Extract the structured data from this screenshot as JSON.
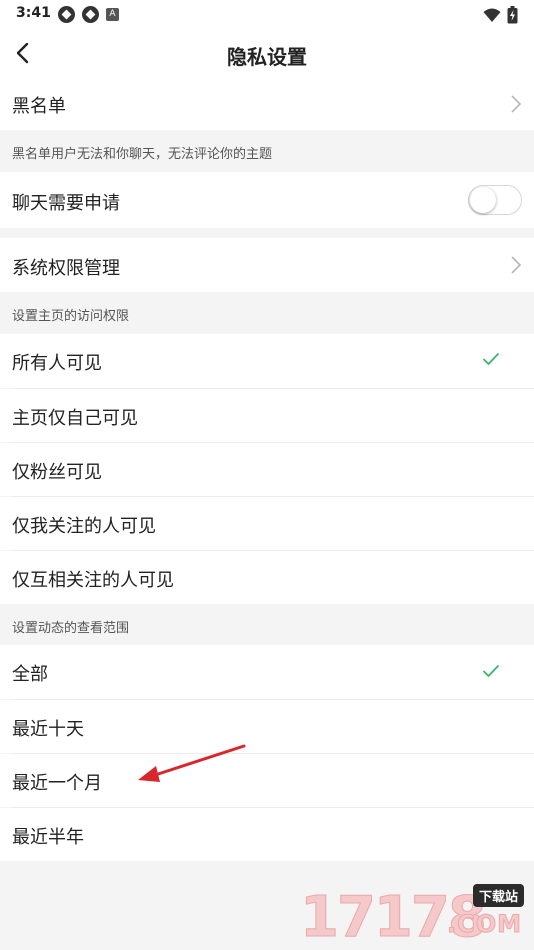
{
  "status": {
    "time": "3:41",
    "badge": "A"
  },
  "header": {
    "title": "隐私设置"
  },
  "blacklist": {
    "label": "黑名单",
    "note": "黑名单用户无法和你聊天，无法评论你的主题"
  },
  "chat_request": {
    "label": "聊天需要申请",
    "enabled": false
  },
  "system_permissions": {
    "label": "系统权限管理"
  },
  "homepage_access": {
    "title": "设置主页的访问权限",
    "options": [
      "所有人可见",
      "主页仅自己可见",
      "仅粉丝可见",
      "仅我关注的人可见",
      "仅互相关注的人可见"
    ],
    "selected": "所有人可见"
  },
  "feed_scope": {
    "title": "设置动态的查看范围",
    "options": [
      "全部",
      "最近十天",
      "最近一个月",
      "最近半年"
    ],
    "selected": "全部"
  },
  "watermark": {
    "digits": "17178",
    "badge": "下载站",
    "domain": ".COM"
  },
  "colors": {
    "accent_check": "#3cb371",
    "arrow": "#d9262b",
    "background": "#f4f4f4"
  }
}
